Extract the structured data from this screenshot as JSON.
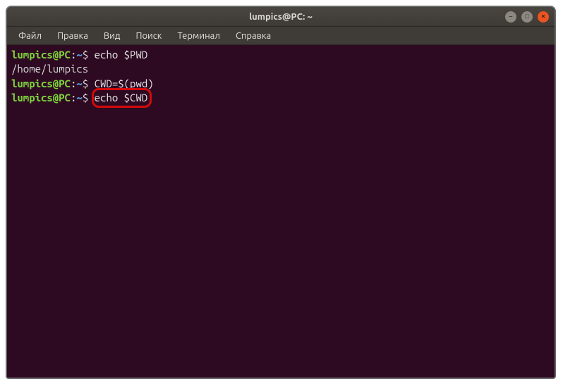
{
  "window": {
    "title": "lumpics@PC: ~"
  },
  "menubar": {
    "items": [
      "Файл",
      "Правка",
      "Вид",
      "Поиск",
      "Терминал",
      "Справка"
    ]
  },
  "terminal": {
    "prompt": {
      "user_host": "lumpics@PC",
      "separator": ":",
      "path": "~",
      "symbol": "$"
    },
    "lines": [
      {
        "type": "cmd",
        "text": "echo $PWD",
        "highlighted": false
      },
      {
        "type": "out",
        "text": "/home/lumpics"
      },
      {
        "type": "cmd",
        "text": "CWD=$(pwd)",
        "highlighted": false
      },
      {
        "type": "cmd",
        "text": "echo $CWD",
        "highlighted": true
      }
    ]
  },
  "controls": {
    "min_glyph": "–",
    "max_glyph": "□",
    "close_glyph": "×"
  }
}
